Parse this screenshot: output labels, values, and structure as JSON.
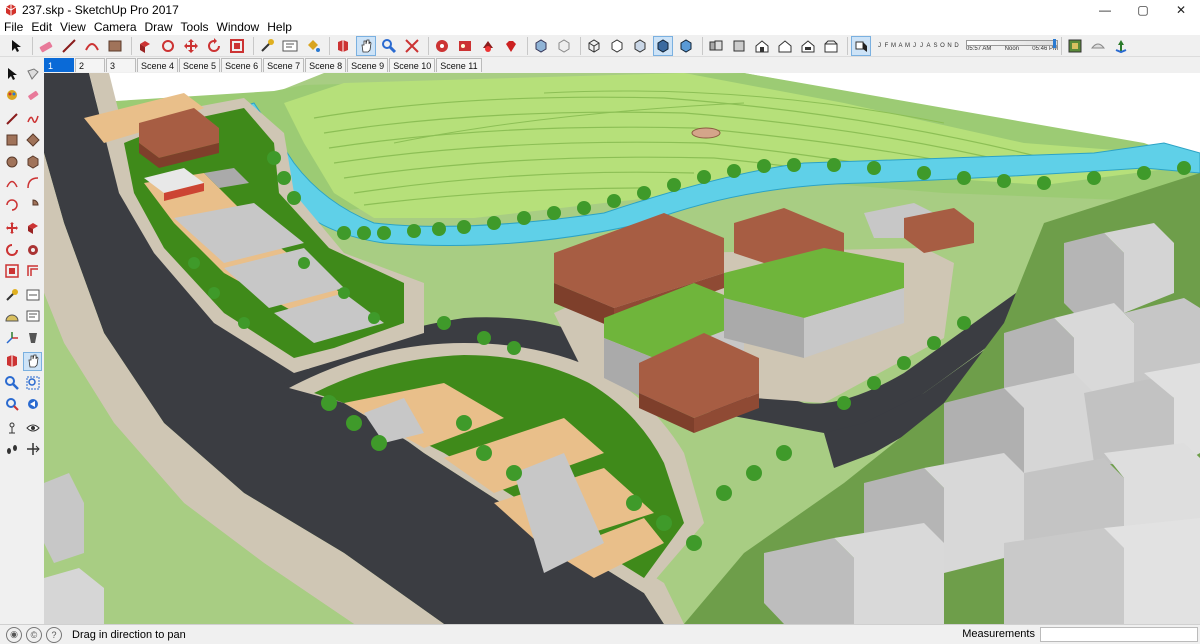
{
  "window": {
    "title": "237.skp - SketchUp Pro 2017",
    "min_glyph": "—",
    "max_glyph": "▢",
    "close_glyph": "✕"
  },
  "menu": [
    "File",
    "Edit",
    "View",
    "Camera",
    "Draw",
    "Tools",
    "Window",
    "Help"
  ],
  "toolbar": {
    "icons": [
      "select-icon",
      "eraser-icon",
      "line-icon",
      "arc-icon",
      "rectangle-icon",
      "push-pull-icon",
      "follow-me-icon",
      "move-icon",
      "rotate-icon",
      "scale-icon",
      "tape-measure-icon",
      "text-icon",
      "paint-bucket-icon",
      "orbit-icon",
      "pan-icon",
      "zoom-icon",
      "zoom-extents-icon",
      "warehouse-icon",
      "extension-icon",
      "ruby-icon",
      "xray-icon",
      "back-edges-icon",
      "wireframe-icon",
      "hidden-line-icon",
      "shaded-icon",
      "shaded-textures-icon",
      "monochrome-icon",
      "iso-view-icon",
      "top-view-icon",
      "front-view-icon",
      "right-view-icon",
      "back-view-icon",
      "left-view-icon",
      "shadows-icon",
      "layers-icon",
      "fog-icon",
      "location-icon"
    ],
    "months": [
      "J",
      "F",
      "M",
      "A",
      "M",
      "J",
      "J",
      "A",
      "S",
      "O",
      "N",
      "D"
    ],
    "time_start": "05:57 AM",
    "time_mid": "Noon",
    "time_end": "05:46 PM",
    "time_value_fraction": 0.95
  },
  "scenes": [
    "1",
    "2",
    "3",
    "Scene 4",
    "Scene 5",
    "Scene 6",
    "Scene 7",
    "Scene 8",
    "Scene 9",
    "Scene 10",
    "Scene 11"
  ],
  "active_scene": "1",
  "palette": [
    "select-icon",
    "make-component-icon",
    "paint-bucket-icon",
    "eraser-icon",
    "line-icon",
    "freehand-icon",
    "rectangle-icon",
    "rotated-rectangle-icon",
    "circle-icon",
    "polygon-icon",
    "arc-icon",
    "two-point-arc-icon",
    "three-point-arc-icon",
    "pie-icon",
    "move-icon",
    "push-pull-icon",
    "rotate-icon",
    "follow-me-icon",
    "scale-icon",
    "offset-icon",
    "tape-measure-icon",
    "dimension-icon",
    "protractor-icon",
    "text-icon",
    "axes-icon",
    "3d-text-icon",
    "orbit-icon",
    "pan-icon",
    "zoom-icon",
    "zoom-window-icon",
    "zoom-extents-icon",
    "previous-icon",
    "position-camera-icon",
    "look-around-icon",
    "walk-icon",
    "section-plane-icon"
  ],
  "status": {
    "hint": "Drag in direction to pan",
    "measurements_label": "Measurements",
    "measurements_value": ""
  },
  "colors": {
    "sky": "#ffffff",
    "grass_light": "#a8cd83",
    "terrain": "#b6e07a",
    "river": "#5fd0e8",
    "road": "#3b3d42",
    "sidewalk": "#cfc6b4",
    "lawn": "#3f8a1a",
    "plaza": "#e9bf8a",
    "roof_brick": "#a75d43",
    "green_roof": "#6fb53b",
    "building_grey": "#c7c7c7",
    "active_tab": "#0a6ad7"
  }
}
